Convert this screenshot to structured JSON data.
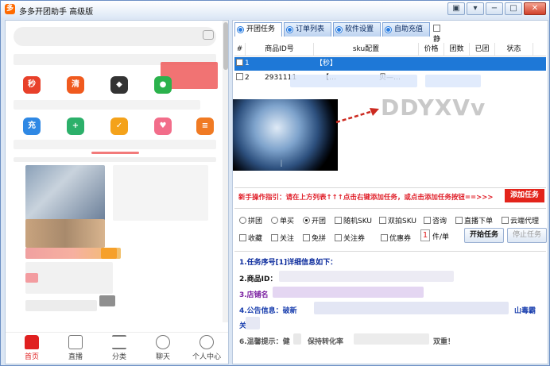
{
  "app": {
    "title": "多多开团助手 高级版",
    "controls": [
      "▣",
      "▾",
      "−",
      "□",
      "✕"
    ]
  },
  "phone": {
    "icons": [
      {
        "label": "秒",
        "color": "#e8402a"
      },
      {
        "label": "清",
        "color": "#f05a1e"
      },
      {
        "label": "◆",
        "color": "#333333"
      },
      {
        "label": "●",
        "color": "#2bb24c"
      },
      {
        "label": "充",
        "color": "#2f88e4"
      },
      {
        "label": "+",
        "color": "#2cb06a"
      },
      {
        "label": "✓",
        "color": "#f4a21a"
      },
      {
        "label": "♥",
        "color": "#f26d8a"
      },
      {
        "label": "≡",
        "color": "#f07a23"
      }
    ],
    "nav": [
      "首页",
      "直播",
      "分类",
      "聊天",
      "个人中心"
    ]
  },
  "tabs": [
    "开团任务",
    "订单列表",
    "软件设置",
    "自助充值"
  ],
  "mute_label": "静音",
  "table": {
    "headers": [
      "#",
      "商品ID号",
      "sku配置",
      "价格",
      "团数",
      "已团",
      "状态"
    ],
    "rows": [
      {
        "no": "1",
        "id": "",
        "sku": "【秒】",
        "selected": true
      },
      {
        "no": "2",
        "id": "2931111",
        "sku": "【…",
        "selected": false,
        "sku_tail": "贝—…"
      }
    ]
  },
  "watermark": "DDYXVv",
  "guide": {
    "text": "新手操作指引：请在上方列表↑↑↑点击右键添加任务，或点击添加任务按钮==>>>",
    "add_button": "添加任务"
  },
  "options": {
    "row1": [
      {
        "label": "拼团",
        "type": "radio",
        "checked": false
      },
      {
        "label": "单买",
        "type": "radio",
        "checked": false
      },
      {
        "label": "开团",
        "type": "radio",
        "checked": true
      },
      {
        "label": "随机SKU",
        "type": "check",
        "checked": false
      },
      {
        "label": "双拍SKU",
        "type": "check",
        "checked": false
      },
      {
        "label": "咨询",
        "type": "check",
        "checked": false
      },
      {
        "label": "直播下单",
        "type": "check",
        "checked": false
      },
      {
        "label": "云端代理",
        "type": "check",
        "checked": false
      }
    ],
    "row2": [
      {
        "label": "收藏",
        "type": "check",
        "checked": false
      },
      {
        "label": "关注",
        "type": "check",
        "checked": false
      },
      {
        "label": "免拼",
        "type": "check",
        "checked": false
      },
      {
        "label": "关注券",
        "type": "check",
        "checked": false
      },
      {
        "label": "优惠券",
        "type": "check",
        "checked": false
      }
    ],
    "quantity": "1",
    "unit": "件/单",
    "start": "开始任务",
    "stop": "停止任务"
  },
  "info": {
    "l1": "1.任务序号[1]详细信息如下：",
    "l2": "2.商品ID：",
    "l3": "3.店铺名",
    "l4": "4.公告信息：破新",
    "l4_tail": "山毒霸",
    "l4b": "关",
    "l6": "6.温馨提示：健",
    "l6_mid": "保持转化率",
    "l6_tail": "双重！"
  }
}
